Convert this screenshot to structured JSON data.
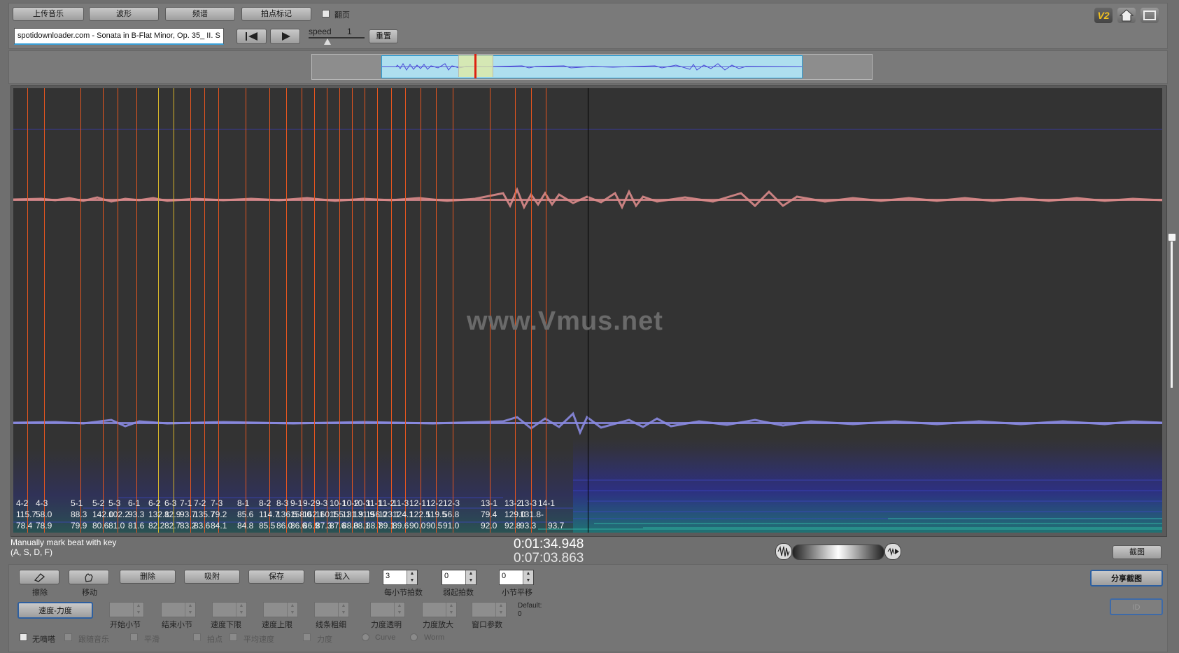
{
  "toolbar": {
    "upload_label": "上传音乐",
    "waveform_label": "波形",
    "spectrum_label": "频谱",
    "beat_mark_label": "拍点标记",
    "page_turn_label": "翻页",
    "filename": "spotidownloader.com - Sonata in B-Flat Minor, Op. 35_ II. S",
    "speed_label": "speed",
    "speed_value": "1",
    "reset_label": "重置",
    "v2_badge": "V2"
  },
  "overlay": {
    "watermark": "www.Vmus.net",
    "beat_labels": [
      {
        "id": "4-2",
        "a": "115.7",
        "b": "78.4"
      },
      {
        "id": "4-3",
        "a": "58.0",
        "b": "78.9"
      },
      {
        "id": "5-1",
        "a": "88.3",
        "b": "79.9"
      },
      {
        "id": "5-2",
        "a": "142.0",
        "b": "80.6"
      },
      {
        "id": "5-3",
        "a": "102.2",
        "b": "81.0"
      },
      {
        "id": "6-1",
        "a": "93.3",
        "b": "81.6"
      },
      {
        "id": "6-2",
        "a": "132.1",
        "b": "82.2"
      },
      {
        "id": "6-3",
        "a": "82.9",
        "b": "82.7"
      },
      {
        "id": "7-1",
        "a": "93.7",
        "b": "83.2"
      },
      {
        "id": "7-2",
        "a": "135.7",
        "b": "83.6"
      },
      {
        "id": "7-3",
        "a": "79.2",
        "b": "84.1"
      },
      {
        "id": "8-1",
        "a": "85.6",
        "b": "84.8"
      },
      {
        "id": "8-2",
        "a": "114.7",
        "b": "85.5"
      },
      {
        "id": "8-3",
        "a": "136.5",
        "b": "86.0"
      },
      {
        "id": "9-1",
        "a": "158.0",
        "b": "86.6"
      },
      {
        "id": "9-2",
        "a": "162.1",
        "b": "86.9"
      },
      {
        "id": "9-3",
        "a": "160.1",
        "b": "87.3"
      },
      {
        "id": "10-1",
        "a": "155.1",
        "b": "87.6"
      },
      {
        "id": "10-2",
        "a": "131.9",
        "b": "88.0"
      },
      {
        "id": "10-3",
        "a": "131.9",
        "b": "88.1"
      },
      {
        "id": "11-1",
        "a": "156.0",
        "b": "88.7"
      },
      {
        "id": "11-2",
        "a": "123.1",
        "b": "89.1"
      },
      {
        "id": "11-3",
        "a": "124.1",
        "b": "89.6"
      },
      {
        "id": "12-1",
        "a": "122.5",
        "b": "90.0"
      },
      {
        "id": "12-2",
        "a": "119.5",
        "b": "90.5"
      },
      {
        "id": "12-3",
        "a": "56.8",
        "b": "91.0"
      },
      {
        "id": "13-1",
        "a": "79.4",
        "b": "92.0"
      },
      {
        "id": "13-2",
        "a": "129.0",
        "b": "92.8"
      },
      {
        "id": "13-3",
        "a": "131.8",
        "b": "93.3"
      },
      {
        "id": "14-1",
        "a": "-",
        "b": "93.7"
      }
    ]
  },
  "status": {
    "hint_line1": "Manually mark beat with key",
    "hint_line2": "(A, S, D, F)",
    "time_current": "0:01:34.948",
    "time_total": "0:07:03.863",
    "screenshot_label": "截图"
  },
  "bottom": {
    "erase_label": "擦除",
    "move_label": "移动",
    "delete_label": "删除",
    "snap_label": "吸附",
    "save_label": "保存",
    "load_label": "载入",
    "beats_per_bar_value": "3",
    "beats_per_bar_label": "每小节拍数",
    "pickup_value": "0",
    "pickup_label": "弱起拍数",
    "bar_shift_value": "0",
    "bar_shift_label": "小节平移",
    "share_label": "分享截图",
    "disabled_btn_label": "ID",
    "tempo_dynamics_label": "速度-力度",
    "start_bar_label": "开始小节",
    "end_bar_label": "结束小节",
    "tempo_lower_label": "速度下限",
    "tempo_upper_label": "速度上限",
    "line_width_label": "线条粗细",
    "dyn_transparency_label": "力度透明",
    "dyn_zoom_label": "力度放大",
    "window_param_label": "窗口参数",
    "default_label": "Default:",
    "default_value": "0",
    "cb_no_tick": "无嘀嗒",
    "cb_follow_music": "跟随音乐",
    "cb_smooth": "平滑",
    "cb_beat": "拍点",
    "cb_avg_tempo": "平均速度",
    "cb_dynamics": "力度",
    "radio_curve": "Curve",
    "radio_worm": "Worm"
  }
}
